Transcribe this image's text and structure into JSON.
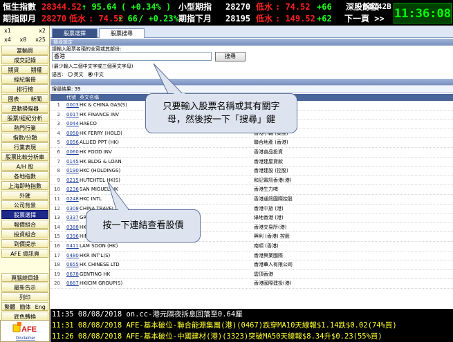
{
  "ticker": {
    "row1": {
      "label1": "恒生指數",
      "value1": "28344.52",
      "change1": "↑ 95.64",
      "pct1": "( +0.34% )",
      "label2": "小型期指",
      "value2": "28270",
      "tag2": "低水",
      "diff2": ": 74.52",
      "change2": "+66",
      "label3": "深股餘額",
      "value3": "51.42B"
    },
    "row2": {
      "label1": "期指即月",
      "value1": "28270",
      "tag1": "低水",
      "diff1": ": 74.52",
      "change1": "↑ 66",
      "pct1": "/ +0.23%",
      "label2": "期指下月",
      "value2": "28195",
      "tag2": "低水",
      "diff2": ": 149.52",
      "change2": "+62",
      "next": "下一頁 >>"
    },
    "clock": "11:36:08",
    "colors": {
      "background": "#000000",
      "up": "#20ff20",
      "down": "#ff2020",
      "highlight": "#ffff30"
    }
  },
  "sidebar": {
    "zoom_row1": [
      "x1",
      "x2"
    ],
    "zoom_row2": [
      "x4",
      "x8",
      "x25"
    ],
    "buttons": [
      "當輸買",
      "成交記錄",
      "",
      "經紀盤冊",
      "排行榜",
      "",
      "異動掃瞄器",
      "股票/經紀分析",
      "熱門行業",
      "指數/分類",
      "行業表現",
      "股票比較分析庫",
      "A/H 股",
      "各地指數",
      "上海即時指數",
      "外匯",
      "公司背景",
      "股票選擇",
      "報價組合",
      "投資組合",
      "到價提示",
      "AFE 資訊頁"
    ],
    "split_buttons": [
      {
        "left": "期貨",
        "right": "期權"
      },
      {
        "left": "國表",
        "right": "新聞"
      }
    ],
    "lower_buttons": [
      "頁腦總目錄",
      "最新告示",
      "列印"
    ],
    "lang": {
      "trad": "繁體",
      "simp": "簡体",
      "eng": "Eng"
    },
    "bottom_button": "底色轉換",
    "logo": {
      "brand": "AFE",
      "sub": "Disclaimer"
    }
  },
  "main": {
    "tabs": [
      {
        "label": "股票選擇",
        "selected": true
      },
      {
        "label": "股票搜尋",
        "selected": false
      }
    ],
    "search_section": "搜尋設定",
    "search_instruction": "請輸入股票名稱的全寫或其部份:",
    "search_value": "香港",
    "search_button": "搜尋",
    "hint": "(最少輸入二個中文字或三個英文字母)",
    "lang_label": "語言:",
    "lang_options": [
      {
        "label": "英文",
        "checked": false
      },
      {
        "label": "中文",
        "checked": true
      }
    ],
    "results_section": "",
    "results_label": "搜尋結果: 39",
    "table_headers": {
      "code": "代號",
      "name": "英文名稱"
    },
    "rows": [
      {
        "no": "1",
        "code": "0003",
        "en": "HK & CHINA GAS(S)",
        "cn": "香港中華煤氣"
      },
      {
        "no": "2",
        "code": "0017",
        "en": "HK FINANCE INV",
        "cn": "香港興業國際"
      },
      {
        "no": "3",
        "code": "0044",
        "en": "HAECO",
        "cn": ""
      },
      {
        "no": "4",
        "code": "0050",
        "en": "HK FERRY (HOLD)",
        "cn": "香港小輪 (集團)"
      },
      {
        "no": "5",
        "code": "0056",
        "en": "ALLIED PPT (HK)",
        "cn": "聯合地產 (香港)"
      },
      {
        "no": "6",
        "code": "0060",
        "en": "HK FOOD INV",
        "cn": "香港食品投資"
      },
      {
        "no": "7",
        "code": "0145",
        "en": "HK BLDG & LOAN",
        "cn": "香港建屋貸款"
      },
      {
        "no": "8",
        "code": "0190",
        "en": "HKC (HOLDINGS)",
        "cn": "香港建設 (控股)"
      },
      {
        "no": "9",
        "code": "0215",
        "en": "HUTCHTEL HK(S)",
        "cn": "和記電訊香港(港)"
      },
      {
        "no": "10",
        "code": "0236",
        "en": "SAN MIGUEL HK",
        "cn": "香港生力啤"
      },
      {
        "no": "11",
        "code": "0248",
        "en": "HKC INTL",
        "cn": "香港通訊國際控股"
      },
      {
        "no": "12",
        "code": "0308",
        "en": "CHINA TRAVEL HK",
        "cn": "香港中旅 (港)"
      },
      {
        "no": "13",
        "code": "0337",
        "en": "GREENLAND HK",
        "cn": "綠地香港 (港)"
      },
      {
        "no": "14",
        "code": "0388",
        "en": "HKEX",
        "cn": "香港交易所(港)"
      },
      {
        "no": "15",
        "code": "0396",
        "en": "HING LEE (HK)",
        "cn": "興利 (香港) 控股"
      },
      {
        "no": "16",
        "code": "0411",
        "en": "LAM SOON (HK)",
        "cn": "南順 (香港)"
      },
      {
        "no": "17",
        "code": "0480",
        "en": "HKR INT'L(S)",
        "cn": "香港興業國際"
      },
      {
        "no": "18",
        "code": "0655",
        "en": "HK CHINESE LTD",
        "cn": "香港華人有限公司"
      },
      {
        "no": "19",
        "code": "0678",
        "en": "GENTING HK",
        "cn": "雲頂香港"
      },
      {
        "no": "20",
        "code": "0687",
        "en": "HKICIM GROUP(S)",
        "cn": "香港國際建投(港)"
      }
    ]
  },
  "callouts": {
    "search_tip": "只要輸入股票名稱或其有關字母，然後按一下「搜尋」鍵",
    "link_tip": "按一下連結查看股價"
  },
  "news": [
    {
      "text": "11:35 08/08/2018 on.cc-港元隔夜拆息回落至0.64厘",
      "color": "#ffffff"
    },
    {
      "text": "11:31 08/08/2018 AFE-基本破位-聯合能源集團(港)(0467)跌穿MA10天線報$1.14跌$0.02(74%買)",
      "color": "#ffff30"
    },
    {
      "text": "11:26 08/08/2018 AFE-基本破位-中國建材(港)(3323)突破MA50天線報$8.34升$0.23(55%買)",
      "color": "#ffff30"
    }
  ]
}
